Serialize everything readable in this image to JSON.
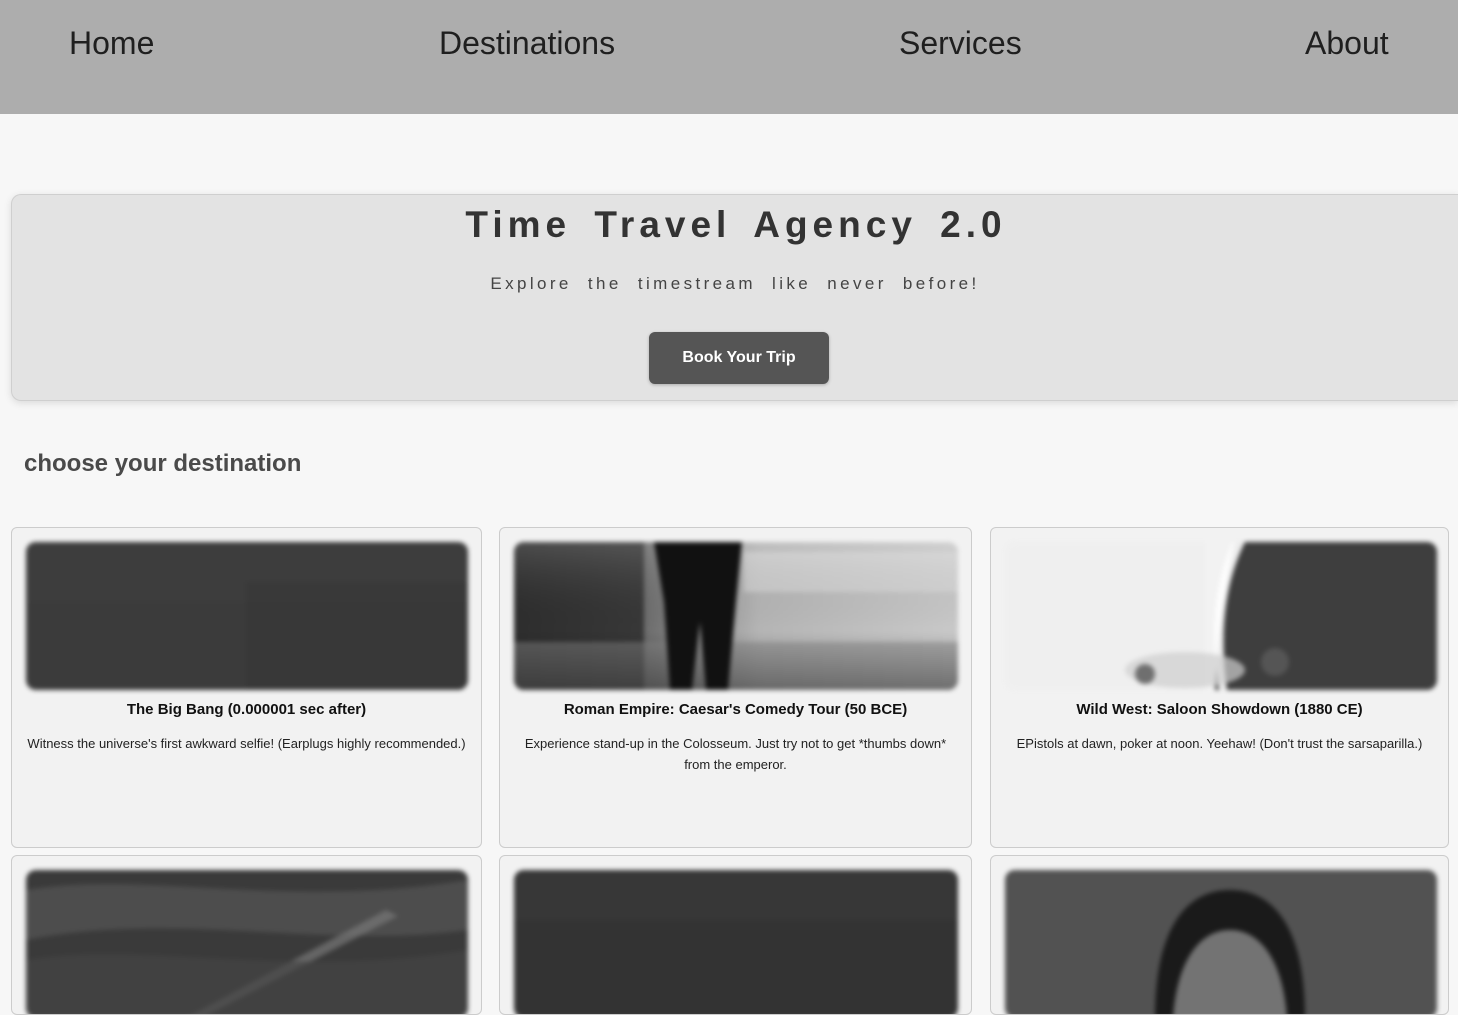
{
  "nav": {
    "items": [
      {
        "label": "Home"
      },
      {
        "label": "Destinations"
      },
      {
        "label": "Services"
      },
      {
        "label": "About"
      }
    ]
  },
  "hero": {
    "title": "Time Travel Agency 2.0",
    "subtitle": "Explore the timestream like never before!",
    "button_label": "Book Your Trip"
  },
  "destinations": {
    "heading": "choose your destination",
    "cards": [
      {
        "title": "The Big Bang (0.000001 sec after)",
        "description": "Witness the universe's first awkward selfie! (Earplugs highly recommended.)"
      },
      {
        "title": "Roman Empire: Caesar's Comedy Tour (50 BCE)",
        "description": "Experience stand-up in the Colosseum. Just try not to get *thumbs down* from the emperor."
      },
      {
        "title": "Wild West: Saloon Showdown (1880 CE)",
        "description": "EPistols at dawn, poker at noon. Yeehaw! (Don't trust the sarsaparilla.)"
      },
      {
        "title": "",
        "description": ""
      },
      {
        "title": "",
        "description": ""
      },
      {
        "title": "",
        "description": ""
      }
    ]
  },
  "colors": {
    "nav_bg": "#adadad",
    "page_bg": "#f7f7f7",
    "hero_bg": "#e3e3e3",
    "button_bg": "#555555",
    "card_bg": "#f2f2f2"
  }
}
